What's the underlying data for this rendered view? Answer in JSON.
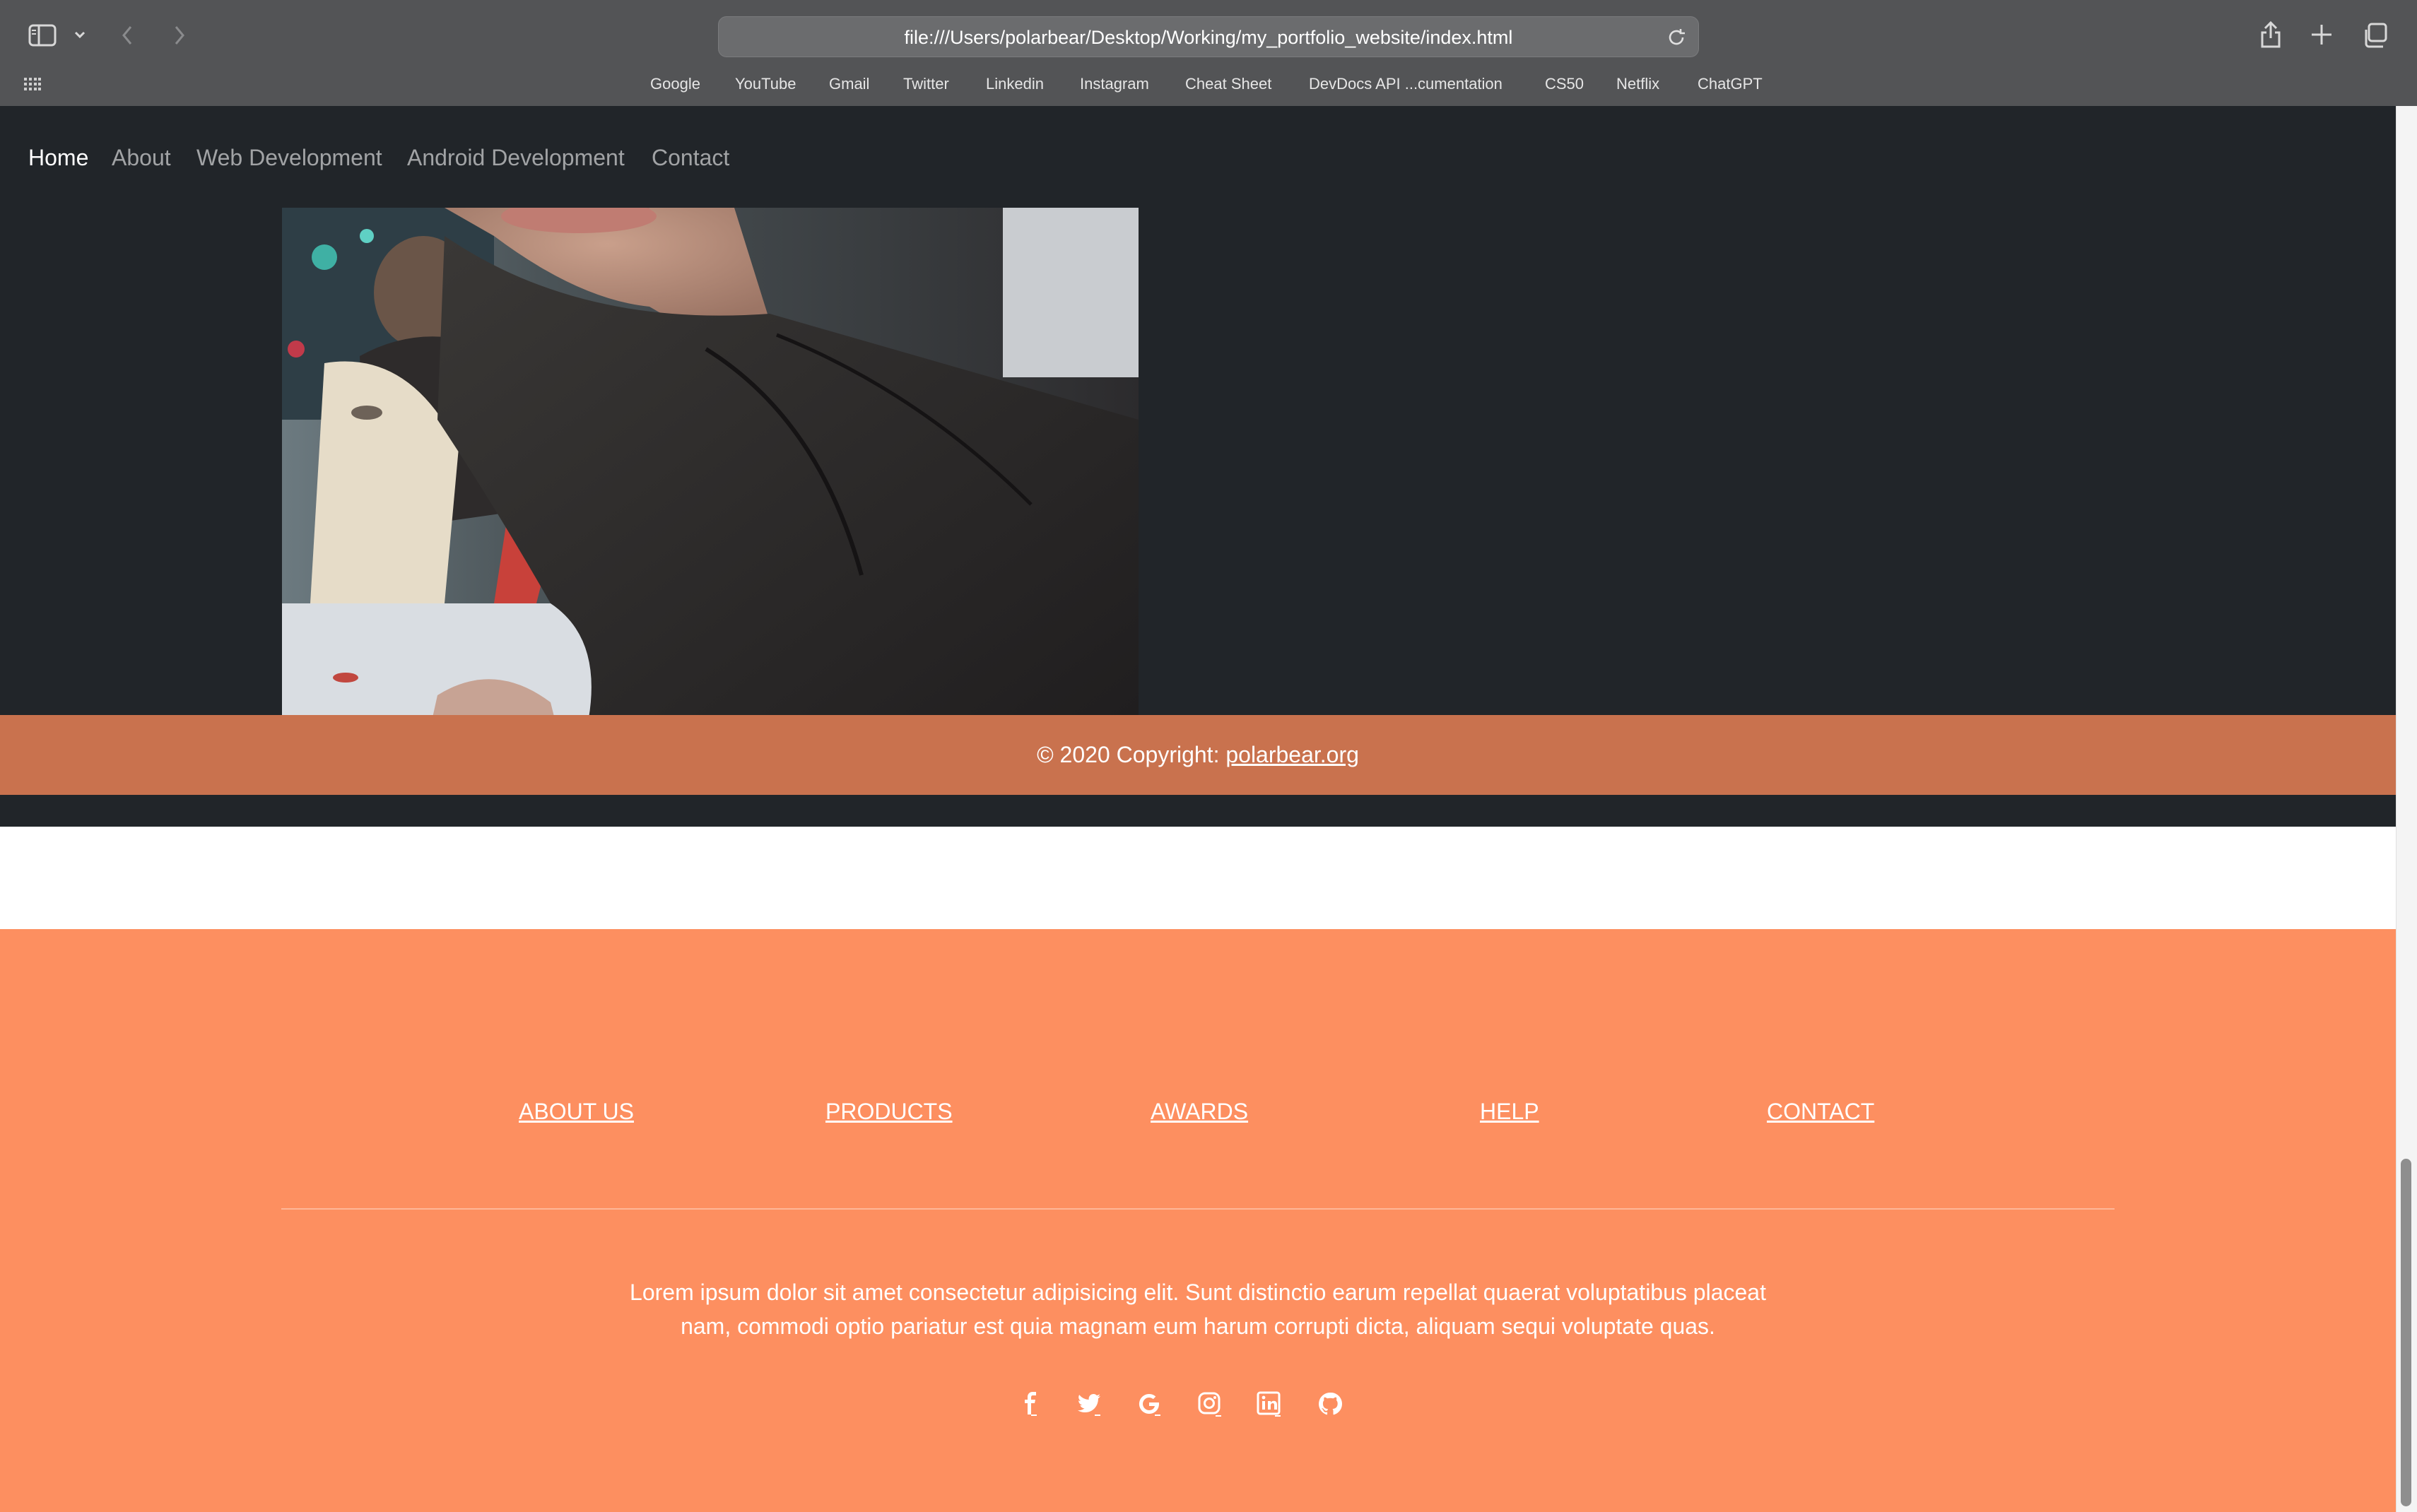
{
  "browser": {
    "url": "file:///Users/polarbear/Desktop/Working/my_portfolio_website/index.html",
    "bookmarks": [
      "Google",
      "YouTube",
      "Gmail",
      "Twitter",
      "Linkedin",
      "Instagram",
      "Cheat Sheet",
      "DevDocs API ...cumentation",
      "CS50",
      "Netflix",
      "ChatGPT"
    ],
    "icons": [
      "sidebar-icon",
      "chevron-down-icon",
      "back-icon",
      "forward-icon",
      "reload-icon",
      "share-icon",
      "new-tab-icon",
      "tab-overview-icon",
      "grid-icon"
    ]
  },
  "nav": {
    "items": [
      "Home",
      "About",
      "Web Development",
      "Android Development",
      "Contact"
    ],
    "active": "Home"
  },
  "footer": {
    "links": [
      "ABOUT US",
      "PRODUCTS",
      "AWARDS",
      "HELP",
      "CONTACT"
    ],
    "text": "Lorem ipsum dolor sit amet consectetur adipisicing elit. Sunt distinctio earum repellat quaerat voluptatibus placeat nam, commodi optio pariatur est quia magnam eum harum corrupti dicta, aliquam sequi voluptate quas.",
    "social_icons": [
      "facebook-icon",
      "twitter-icon",
      "google-icon",
      "instagram-icon",
      "linkedin-icon",
      "github-icon"
    ]
  },
  "copyright": {
    "prefix": "© 2020 Copyright: ",
    "link": "polarbear.org"
  },
  "colors": {
    "chrome": "#535456",
    "dark_section": "#212529",
    "footer": "#fd8f60",
    "copyright_bar": "#c9724e"
  }
}
